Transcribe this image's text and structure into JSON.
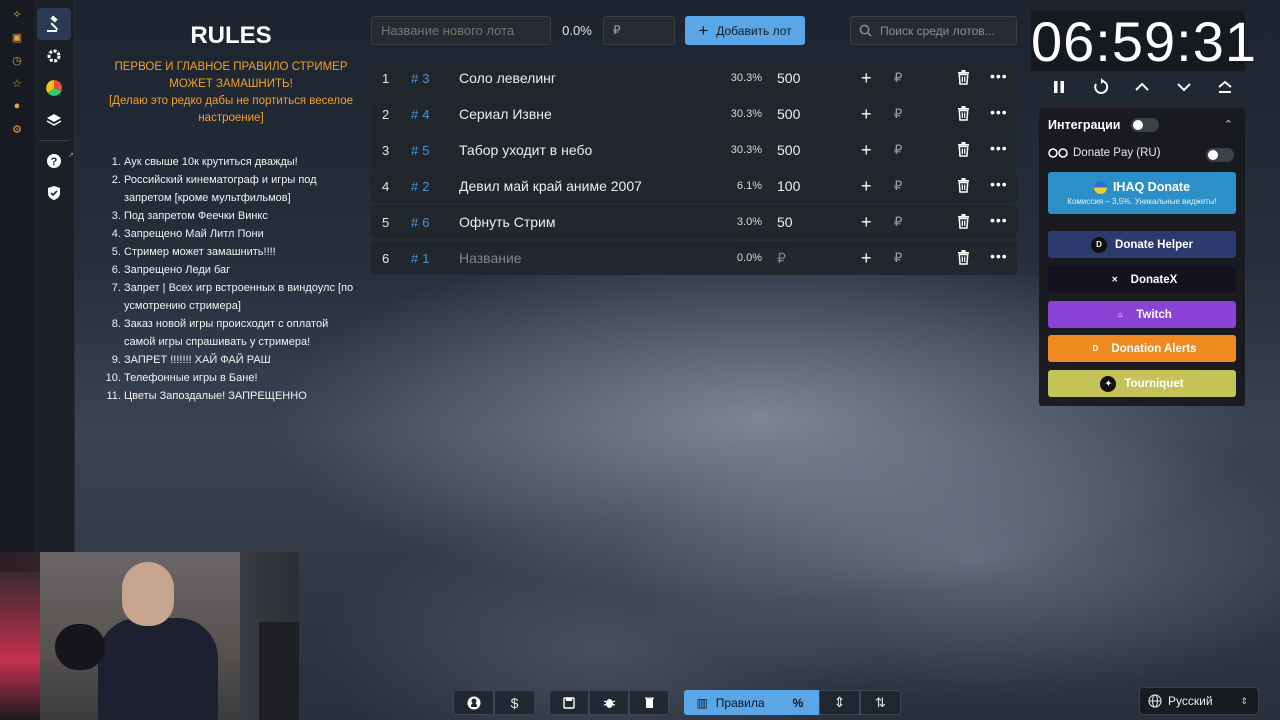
{
  "rules": {
    "title": "RULES",
    "warning": "ПЕРВОЕ И ГЛАВНОЕ ПРАВИЛО СТРИМЕР МОЖЕТ ЗАМАШНИТЬ!",
    "note": "[Делаю это редко дабы не портиться веселое настроение]",
    "items": [
      "Аук свыше 10к крутиться дважды!",
      "Российский кинематограф и игры  под запретом [кроме мультфильмов]",
      "Под запретом Феечки Винкс",
      "Запрещено Май Литл Пони",
      "Стример может замашнить!!!!",
      "Запрещено Леди баг",
      "Запрет | Всех игр встроенных в виндоулс [по усмотрению стримера]",
      "Заказ новой игры происходит с оплатой самой игры спрашивать у стримера!",
      "ЗАПРЕТ !!!!!!! ХАЙ ФАЙ РАШ",
      "Телефонные игры в Бане!",
      "Цветы Запоздалые! ЗАПРЕЩЕННО"
    ]
  },
  "new_lot": {
    "name_placeholder": "Название нового лота",
    "percent": "0.0%",
    "amount_placeholder": "₽",
    "add_label": "Добавить лот"
  },
  "search": {
    "placeholder": "Поиск среди лотов..."
  },
  "lots": [
    {
      "index": "1",
      "id": "3",
      "name": "Соло левелинг",
      "percent": "30.3%",
      "amount": "500"
    },
    {
      "index": "2",
      "id": "4",
      "name": "Сериал Извне",
      "percent": "30.3%",
      "amount": "500"
    },
    {
      "index": "3",
      "id": "5",
      "name": "Табор уходит в небо",
      "percent": "30.3%",
      "amount": "500"
    },
    {
      "index": "4",
      "id": "2",
      "name": "Девил май край аниме 2007",
      "percent": "6.1%",
      "amount": "100"
    },
    {
      "index": "5",
      "id": "6",
      "name": "Офнуть Стрим",
      "percent": "3.0%",
      "amount": "50"
    },
    {
      "index": "6",
      "id": "1",
      "name": "Название",
      "percent": "0.0%",
      "amount": "₽",
      "empty": true
    }
  ],
  "lot_currency": "₽",
  "lot_id_prefix": "#",
  "timer": {
    "value": "06:59:31"
  },
  "integrations": {
    "title": "Интеграции",
    "donate_pay": "Donate Pay (RU)",
    "ihaq": {
      "title": "IHAQ Donate",
      "subtitle": "Комиссия – 3,5%. Уникальные виджеты!"
    },
    "services": [
      {
        "label": "Donate Helper",
        "color": "#2c3a6e",
        "icon": "D",
        "icon_bg": "#111"
      },
      {
        "label": "DonateX",
        "color": "#16111f",
        "icon": "✕",
        "icon_bg": "transparent"
      },
      {
        "label": "Twitch",
        "color": "#8a43d6",
        "icon": "⌂",
        "icon_bg": "transparent"
      },
      {
        "label": "Donation Alerts",
        "color": "#ee8a1f",
        "icon": "D",
        "icon_bg": "transparent"
      },
      {
        "label": "Tourniquet",
        "color": "#c3c35a",
        "icon": "✦",
        "icon_bg": "#111"
      }
    ]
  },
  "bottom_bar": {
    "rules_label": "Правила",
    "percent_label": "%"
  },
  "language": {
    "label": "Русский"
  },
  "colors": {
    "accent": "#5aa6e6",
    "warning": "#f0a030",
    "lot_id": "#4a95d8"
  }
}
